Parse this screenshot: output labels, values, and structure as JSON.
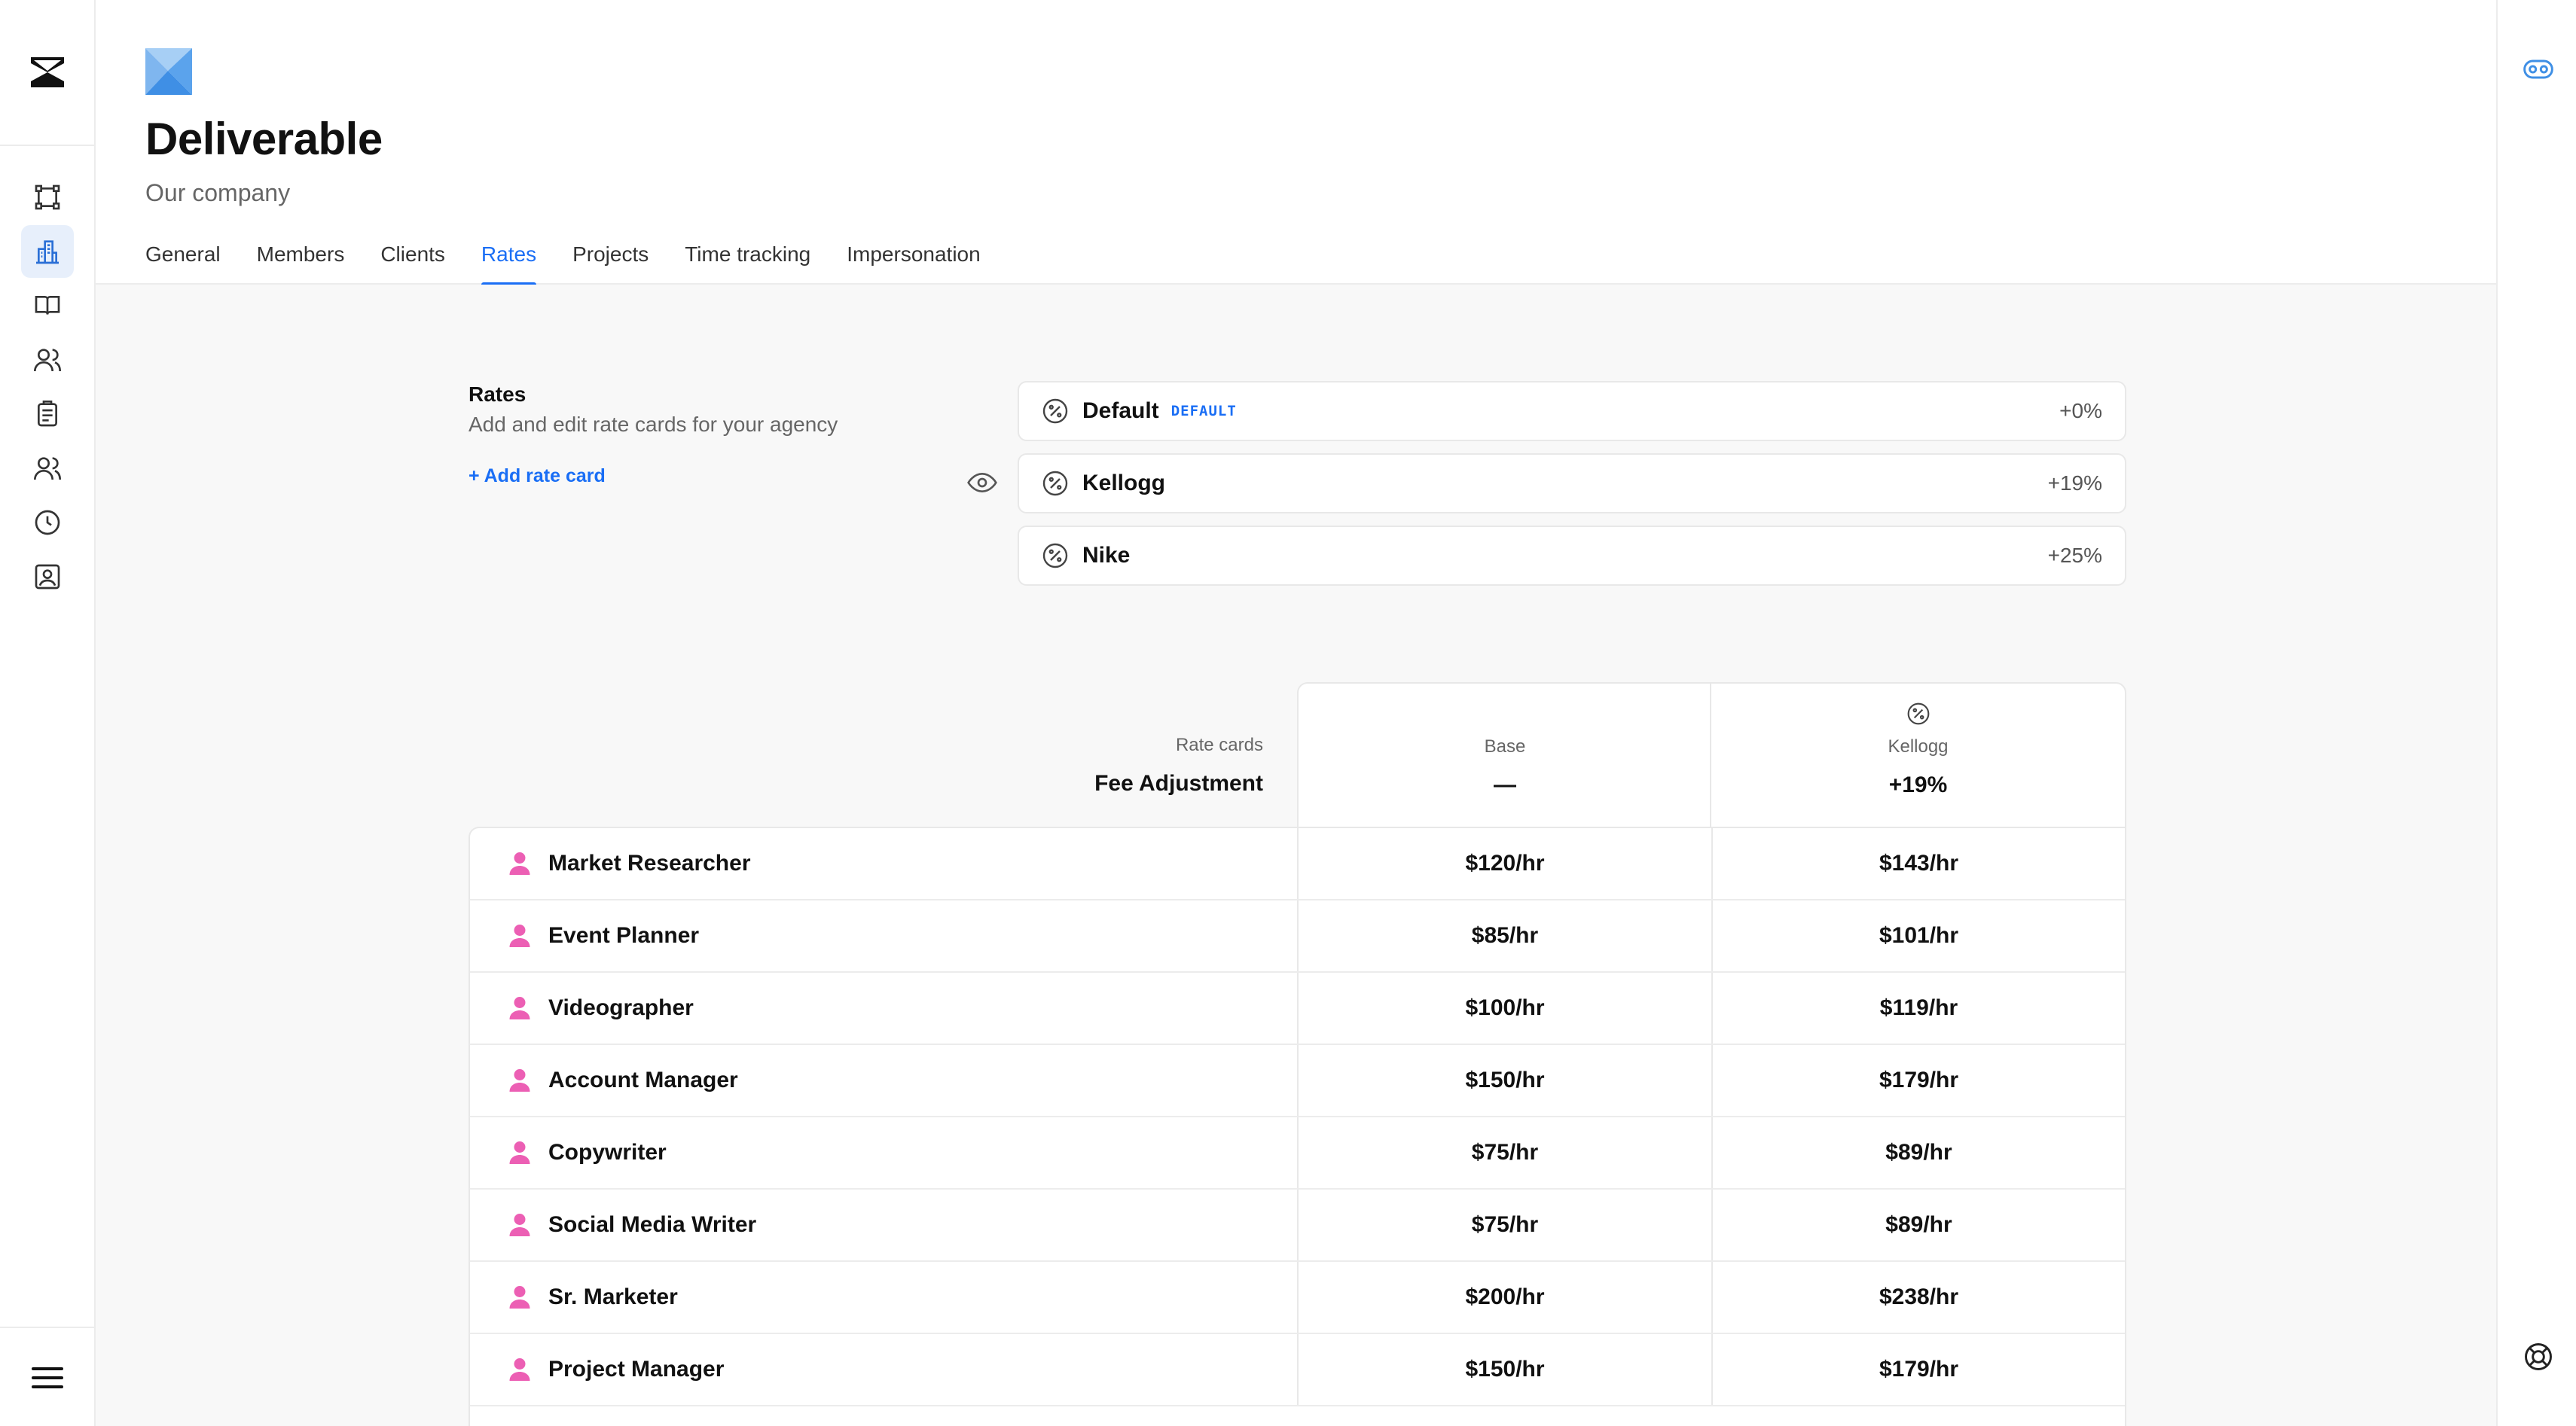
{
  "nav": {
    "items": [
      {
        "icon": "frame-icon"
      },
      {
        "icon": "buildings-icon",
        "active": true
      },
      {
        "icon": "book-icon"
      },
      {
        "icon": "users-icon"
      },
      {
        "icon": "clipboard-icon"
      },
      {
        "icon": "team-icon"
      },
      {
        "icon": "clock-icon"
      },
      {
        "icon": "contact-card-icon"
      }
    ]
  },
  "header": {
    "title": "Deliverable",
    "subtitle": "Our company",
    "tabs": [
      "General",
      "Members",
      "Clients",
      "Rates",
      "Projects",
      "Time tracking",
      "Impersonation"
    ],
    "active_tab": "Rates"
  },
  "rates": {
    "title": "Rates",
    "description": "Add and edit rate cards for your agency",
    "add_label": "+ Add rate card",
    "cards": [
      {
        "name": "Default",
        "badge": "DEFAULT",
        "value": "+0%"
      },
      {
        "name": "Kellogg",
        "badge": "",
        "value": "+19%"
      },
      {
        "name": "Nike",
        "badge": "",
        "value": "+25%"
      }
    ]
  },
  "table": {
    "header_label": "Rate cards",
    "header_sublabel": "Fee Adjustment",
    "columns": [
      {
        "label": "Base",
        "adjustment": "—"
      },
      {
        "label": "Kellogg",
        "adjustment": "+19%"
      }
    ],
    "rows": [
      {
        "role": "Market Researcher",
        "base": "$120/hr",
        "kellogg": "$143/hr"
      },
      {
        "role": "Event Planner",
        "base": "$85/hr",
        "kellogg": "$101/hr"
      },
      {
        "role": "Videographer",
        "base": "$100/hr",
        "kellogg": "$119/hr"
      },
      {
        "role": "Account Manager",
        "base": "$150/hr",
        "kellogg": "$179/hr"
      },
      {
        "role": "Copywriter",
        "base": "$75/hr",
        "kellogg": "$89/hr"
      },
      {
        "role": "Social Media Writer",
        "base": "$75/hr",
        "kellogg": "$89/hr"
      },
      {
        "role": "Sr. Marketer",
        "base": "$200/hr",
        "kellogg": "$238/hr"
      },
      {
        "role": "Project Manager",
        "base": "$150/hr",
        "kellogg": "$179/hr"
      }
    ]
  },
  "colors": {
    "accent": "#1a6ef5",
    "person_icon": "#ec5fb4",
    "brand_light": "#7fb6ef",
    "brand_dark": "#3f8fe5"
  }
}
